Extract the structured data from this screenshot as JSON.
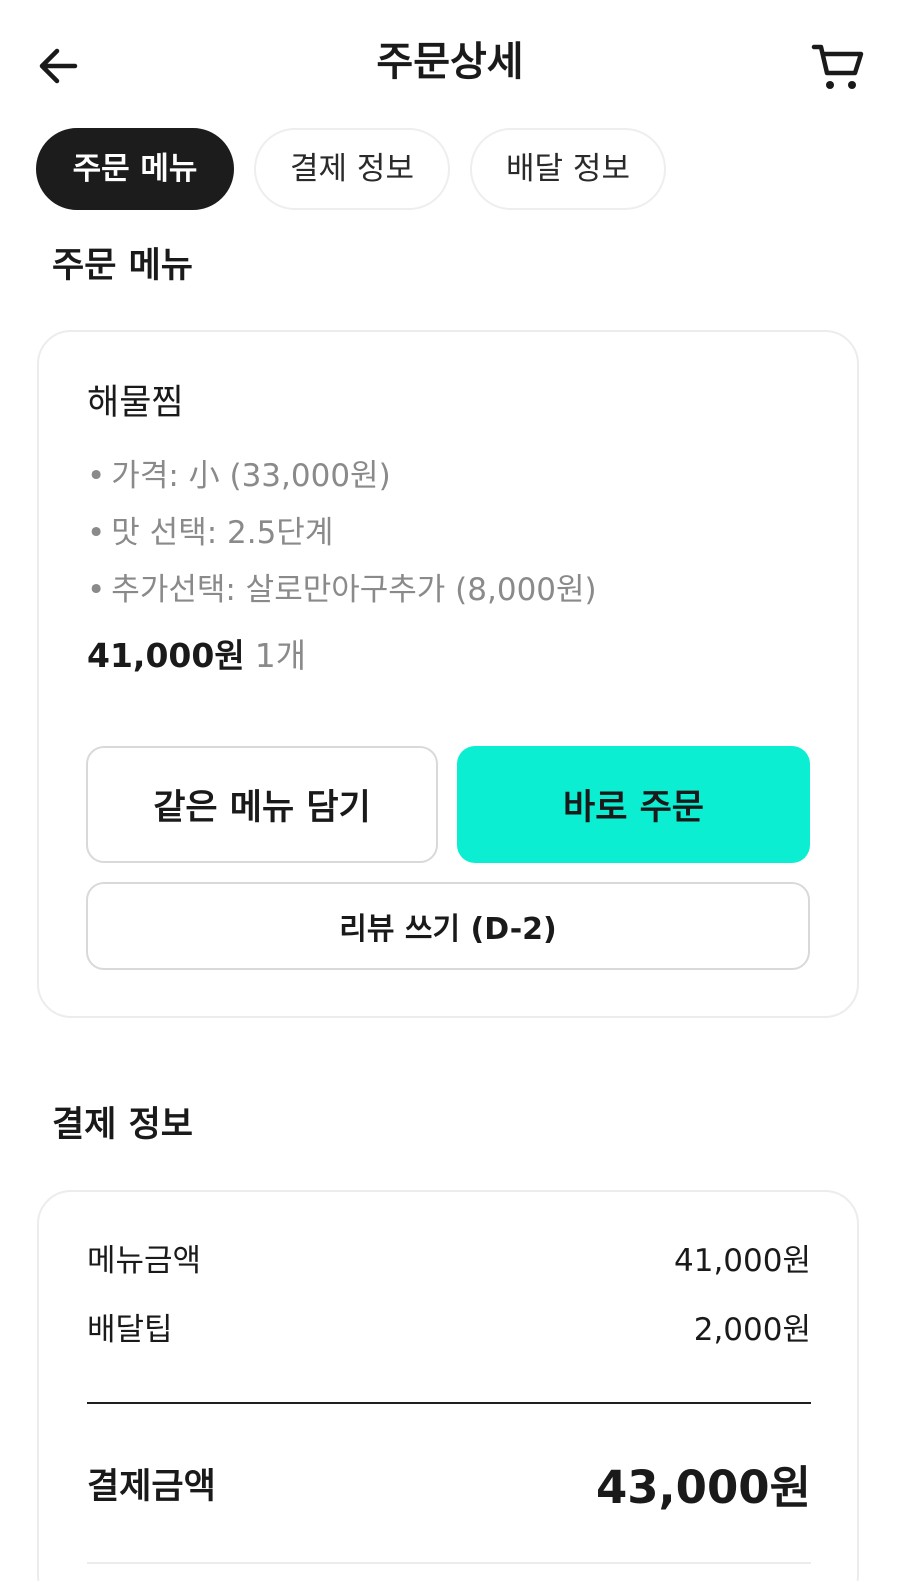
{
  "header": {
    "title": "주문상세",
    "back_icon": "arrow-left-icon",
    "cart_icon": "cart-icon"
  },
  "tabs": [
    {
      "label": "주문 메뉴",
      "active": true
    },
    {
      "label": "결제 정보",
      "active": false
    },
    {
      "label": "배달 정보",
      "active": false
    }
  ],
  "order_section": {
    "title": "주문 메뉴",
    "item": {
      "name": "해물찜",
      "options": [
        "가격: 小 (33,000원)",
        "맛 선택: 2.5단계",
        "추가선택: 살로만아구추가 (8,000원)"
      ],
      "price": "41,000원",
      "quantity": "1개"
    },
    "buttons": {
      "add_same": "같은 메뉴 담기",
      "order_now": "바로 주문",
      "write_review": "리뷰 쓰기 (D-2)"
    }
  },
  "payment_section": {
    "title": "결제 정보",
    "rows": [
      {
        "label": "메뉴금액",
        "value": "41,000원"
      },
      {
        "label": "배달팁",
        "value": "2,000원"
      }
    ],
    "total_label": "결제금액",
    "total_value": "43,000원"
  },
  "colors": {
    "accent": "#0ceed2",
    "active_tab": "#1c1c1c",
    "muted_text": "#8a8a8a"
  }
}
